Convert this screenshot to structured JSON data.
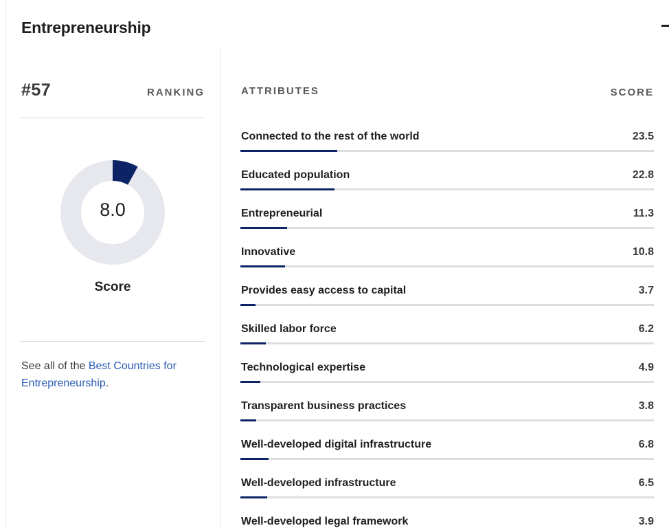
{
  "section": {
    "title": "Entrepreneurship"
  },
  "ranking": {
    "number": "#57",
    "label": "RANKING"
  },
  "score": {
    "value": "8.0",
    "fraction": 0.08,
    "caption": "Score"
  },
  "footer": {
    "text_before": "See all of the ",
    "link_text": "Best Countries for Entrepreneurship",
    "text_after": "."
  },
  "attributes": {
    "header_label": "ATTRIBUTES",
    "score_label": "SCORE",
    "items": [
      {
        "name": "Connected to the rest of the world",
        "score": "23.5",
        "fraction": 0.235
      },
      {
        "name": "Educated population",
        "score": "22.8",
        "fraction": 0.228
      },
      {
        "name": "Entrepreneurial",
        "score": "11.3",
        "fraction": 0.113
      },
      {
        "name": "Innovative",
        "score": "10.8",
        "fraction": 0.108
      },
      {
        "name": "Provides easy access to capital",
        "score": "3.7",
        "fraction": 0.037
      },
      {
        "name": "Skilled labor force",
        "score": "6.2",
        "fraction": 0.062
      },
      {
        "name": "Technological expertise",
        "score": "4.9",
        "fraction": 0.049
      },
      {
        "name": "Transparent business practices",
        "score": "3.8",
        "fraction": 0.038
      },
      {
        "name": "Well-developed digital infrastructure",
        "score": "6.8",
        "fraction": 0.068
      },
      {
        "name": "Well-developed infrastructure",
        "score": "6.5",
        "fraction": 0.065
      },
      {
        "name": "Well-developed legal framework",
        "score": "3.9",
        "fraction": 0.039
      }
    ]
  },
  "colors": {
    "accent": "#0c2466",
    "track": "#dcdee3",
    "link": "#2a5bb5"
  }
}
